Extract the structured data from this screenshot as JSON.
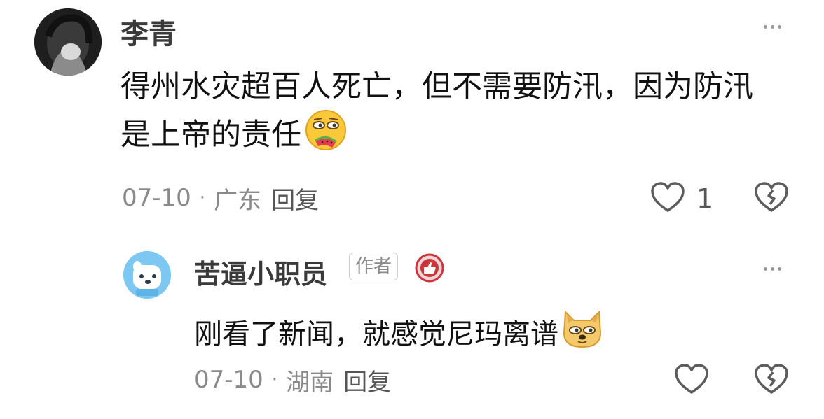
{
  "comments": [
    {
      "author": "李青",
      "text_line1": "得州水灾超百人死亡，但不需要防汛，因为防汛",
      "text_line2": "是上帝的责任",
      "emoji": "melon-eating-face-emoji",
      "date": "07-10",
      "separator": "·",
      "location": "广东",
      "reply": "回复",
      "likes": "1",
      "icons": {
        "like": "heart-outline-icon",
        "dislike": "broken-heart-icon",
        "more": "more-dots-icon"
      }
    }
  ],
  "reply": {
    "author": "苦逼小职员",
    "author_badge": "作者",
    "badge_icon": "thumbs-up-badge-icon",
    "text": "刚看了新闻，就感觉尼玛离谱",
    "emoji": "doge-emoji",
    "date": "07-10",
    "separator": "·",
    "location": "湖南",
    "reply": "回复",
    "icons": {
      "like": "heart-outline-icon",
      "dislike": "broken-heart-icon",
      "more": "more-dots-icon"
    }
  },
  "colors": {
    "badge_red": "#c9363c",
    "avatar_blue": "#7cc8f2"
  }
}
